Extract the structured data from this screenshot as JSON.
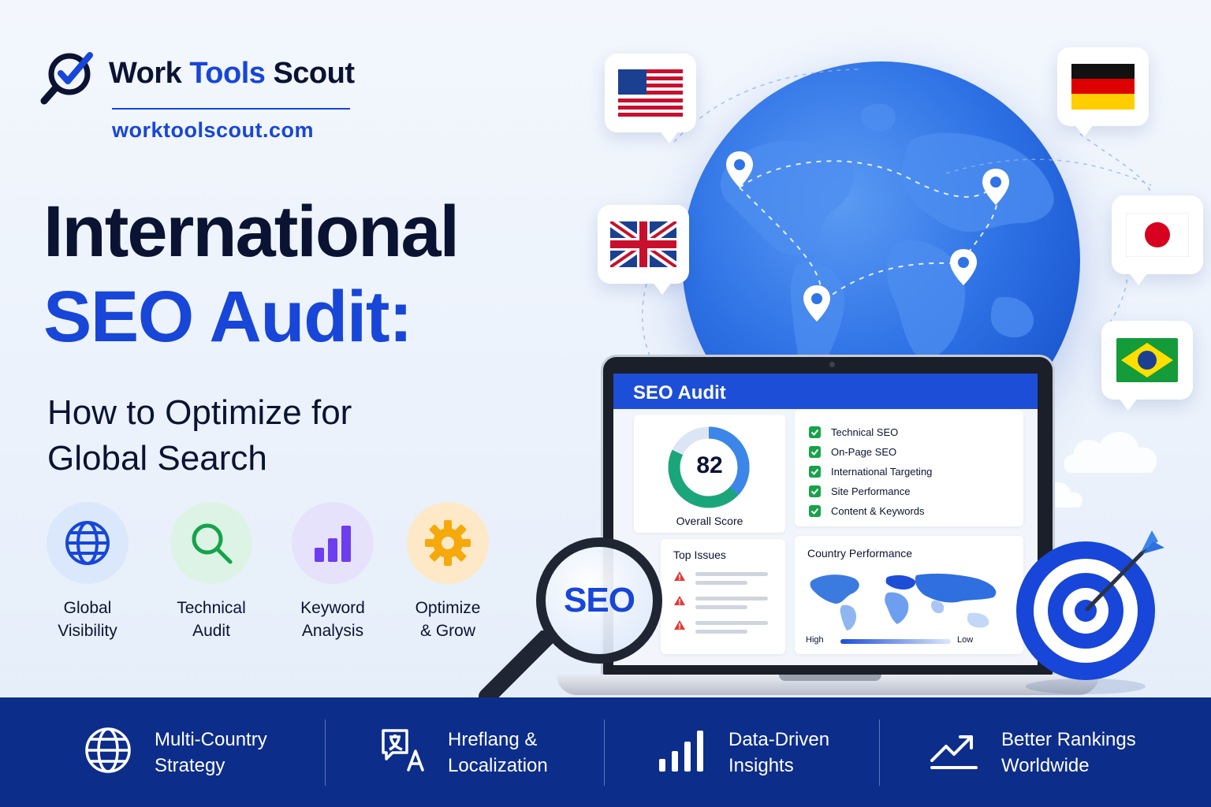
{
  "brand": {
    "name_part1": "Work ",
    "name_accent": "Tools",
    "name_part2": " Scout",
    "url": "worktoolscout.com"
  },
  "headline": {
    "line1": "International",
    "line2": "SEO Audit:",
    "subtitle_line1": "How to Optimize for",
    "subtitle_line2": "Global Search"
  },
  "features": [
    {
      "line1": "Global",
      "line2": "Visibility",
      "icon": "globe-icon",
      "bg": "#dbe8fb",
      "fg": "#1746d8"
    },
    {
      "line1": "Technical",
      "line2": "Audit",
      "icon": "magnifier-icon",
      "bg": "#dcf3e6",
      "fg": "#16a34a"
    },
    {
      "line1": "Keyword",
      "line2": "Analysis",
      "icon": "bar-chart-icon",
      "bg": "#e6e2fb",
      "fg": "#6d3df0"
    },
    {
      "line1": "Optimize",
      "line2": "& Grow",
      "icon": "gear-icon",
      "bg": "#fde9c7",
      "fg": "#f5a90b"
    }
  ],
  "flags": [
    {
      "country": "United States",
      "icon": "us-flag-icon"
    },
    {
      "country": "United Kingdom",
      "icon": "uk-flag-icon"
    },
    {
      "country": "Germany",
      "icon": "germany-flag-icon"
    },
    {
      "country": "Japan",
      "icon": "japan-flag-icon"
    },
    {
      "country": "Brazil",
      "icon": "brazil-flag-icon"
    }
  ],
  "dashboard": {
    "title": "SEO Audit",
    "score": "82",
    "score_fraction": 0.82,
    "score_label": "Overall Score",
    "checklist": [
      "Technical SEO",
      "On-Page SEO",
      "International Targeting",
      "Site Performance",
      "Content & Keywords"
    ],
    "top_issues_title": "Top Issues",
    "top_issues_count": 3,
    "country_title": "Country Performance",
    "legend_high": "High",
    "legend_low": "Low"
  },
  "magnifier_text": "SEO",
  "bottom_bar": [
    {
      "line1": "Multi-Country",
      "line2": "Strategy",
      "icon": "globe-icon"
    },
    {
      "line1": "Hreflang &",
      "line2": "Localization",
      "icon": "translate-icon"
    },
    {
      "line1": "Data-Driven",
      "line2": "Insights",
      "icon": "bar-chart-icon"
    },
    {
      "line1": "Better Rankings",
      "line2": "Worldwide",
      "icon": "trend-up-icon"
    }
  ],
  "colors": {
    "brand_blue": "#1746d8",
    "navy": "#0b1333",
    "bottom_bar": "#0c2d8a",
    "check_green": "#16a34a",
    "warning_red": "#e53935"
  }
}
